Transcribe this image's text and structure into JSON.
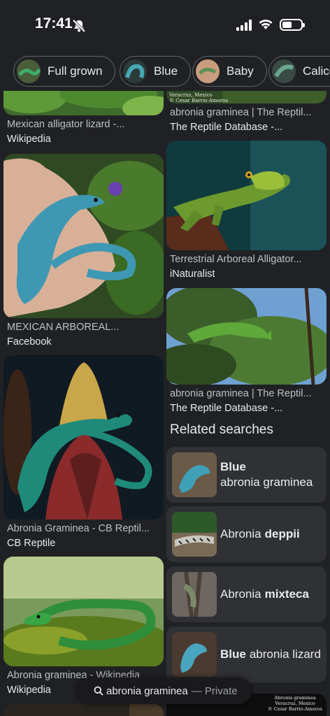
{
  "status": {
    "time": "17:41"
  },
  "chips": [
    {
      "label": "Full grown",
      "color": "#3b6f4a"
    },
    {
      "label": "Blue",
      "color": "#3a8e9a"
    },
    {
      "label": "Baby",
      "color": "#b58a6c"
    },
    {
      "label": "Calico",
      "color": "#3d6a5f"
    }
  ],
  "results": {
    "r1": {
      "title": "Mexican alligator lizard -...",
      "source": "Wikipedia"
    },
    "r2": {
      "title": "abronia graminea | The Reptil...",
      "source": "The Reptile Database -...",
      "overlay": "Veracruz, Mexico\n© Cesar Barrio-Amoros"
    },
    "r3": {
      "title": "Terrestrial Arboreal Alligator...",
      "source": "iNaturalist"
    },
    "r4": {
      "title": "MEXICAN ARBOREAL...",
      "source": "Facebook"
    },
    "r5": {
      "title": "abronia graminea | The Reptil...",
      "source": "The Reptile Database -..."
    },
    "r6": {
      "title": "Abronia Graminea - CB Reptil...",
      "source": "CB Reptile"
    },
    "r7": {
      "title": "Abronia graminea - Wikipedia",
      "source": "Wikipedia"
    },
    "r8": {
      "overlay": "Abronia graminea\nVeracruz, Mexico\n© Cesar Barrio-Amoros"
    }
  },
  "related": {
    "title": "Related searches",
    "items": [
      {
        "bold": "Blue",
        "text": "abronia graminea"
      },
      {
        "pre": "Abronia",
        "bold": "deppii"
      },
      {
        "pre": "Abronia",
        "bold": "mixteca"
      },
      {
        "bold": "Blue",
        "text": "abronia lizard"
      }
    ]
  },
  "search": {
    "query": "abronia graminea",
    "mode": "— Private"
  }
}
